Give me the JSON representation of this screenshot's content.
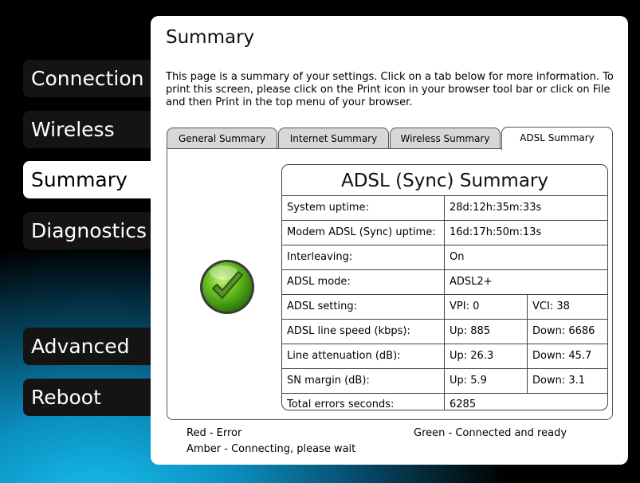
{
  "nav": {
    "items": [
      {
        "label": "Connection"
      },
      {
        "label": "Wireless"
      },
      {
        "label": "Summary"
      },
      {
        "label": "Diagnostics"
      },
      {
        "label": "Advanced"
      },
      {
        "label": "Reboot"
      }
    ],
    "active": "Summary"
  },
  "page": {
    "title": "Summary",
    "intro": "This page is a summary of your settings. Click on a tab below for more information. To print this screen, please click on the Print icon in your browser tool bar or click on File and then Print in the top menu of your browser."
  },
  "tabs": [
    {
      "label": "General Summary"
    },
    {
      "label": "Internet Summary"
    },
    {
      "label": "Wireless Summary"
    },
    {
      "label": "ADSL Summary"
    }
  ],
  "active_tab": "ADSL Summary",
  "status_icon": {
    "name": "green-check-icon",
    "color": "#4caf1a"
  },
  "summary": {
    "title": "ADSL (Sync) Summary",
    "rows": [
      {
        "label": "System uptime:",
        "value": "28d:12h:35m:33s"
      },
      {
        "label": "Modem ADSL (Sync) uptime:",
        "value": "16d:17h:50m:13s"
      },
      {
        "label": "Interleaving:",
        "value": "On"
      },
      {
        "label": "ADSL mode:",
        "value": "ADSL2+"
      },
      {
        "label": "ADSL setting:",
        "value": "VPI: 0",
        "value2": "VCI: 38"
      },
      {
        "label": "ADSL line speed (kbps):",
        "value": "Up: 885",
        "value2": "Down: 6686"
      },
      {
        "label": "Line attenuation (dB):",
        "value": "Up: 26.3",
        "value2": "Down: 45.7"
      },
      {
        "label": "SN margin (dB):",
        "value": "Up: 5.9",
        "value2": "Down: 3.1"
      },
      {
        "label": "Total errors seconds:",
        "value": "6285"
      }
    ]
  },
  "legend": {
    "red": "Red - Error",
    "green": "Green - Connected and ready",
    "amber": "Amber - Connecting, please wait"
  }
}
